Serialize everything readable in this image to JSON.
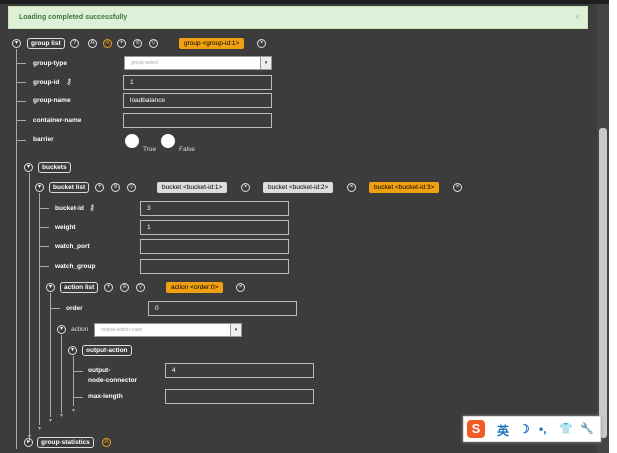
{
  "alert": {
    "message": "Loading completed successfully",
    "close": "×"
  },
  "group_list": {
    "label": "group list",
    "key_button": "group  <group-id:1>",
    "fields": {
      "group_type": {
        "label": "group-type",
        "value": "group-select"
      },
      "group_id": {
        "label": "group-id",
        "value": "1"
      },
      "group_name": {
        "label": "group-name",
        "value": "loadbalance"
      },
      "container_name": {
        "label": "container-name",
        "value": ""
      },
      "barrier": {
        "label": "barrier",
        "true_label": "True",
        "false_label": "False"
      }
    }
  },
  "buckets": {
    "label": "buckets",
    "bucket_list": {
      "label": "bucket list",
      "keys": [
        "bucket  <bucket-id:1>",
        "bucket  <bucket-id:2>",
        "bucket  <bucket-id:3>"
      ],
      "fields": {
        "bucket_id": {
          "label": "bucket-id",
          "value": "3"
        },
        "weight": {
          "label": "weight",
          "value": "1"
        },
        "watch_port": {
          "label": "watch_port",
          "value": ""
        },
        "watch_group": {
          "label": "watch_group",
          "value": ""
        }
      },
      "action_list": {
        "label": "action list",
        "key_button": "action  <order:0>",
        "order": {
          "label": "order",
          "value": "0"
        },
        "action": {
          "label": "action",
          "value": "output-action-case"
        },
        "output_action": {
          "label": "output-action",
          "node_connector_label_1": "output-",
          "node_connector_label_2": "node-connector",
          "node_connector_value": "4",
          "max_length_label": "max-length",
          "max_length_value": ""
        }
      }
    }
  },
  "group_statistics": {
    "label": "group-statistics"
  },
  "icons": {
    "add": "+",
    "remove": "×",
    "help": "?",
    "augment": "A",
    "filter": "▽",
    "list": "≡",
    "expand": "▾",
    "collapse": "▸",
    "key": "⚷"
  },
  "ime_bar": {
    "logo": "S",
    "lang": "英",
    "moon": "☽",
    "punct": "•,",
    "shirt": "👕",
    "tool": "🔧"
  },
  "colors": {
    "background": "#3c3c3c",
    "accent": "#f0a010",
    "alert_bg": "#dff0d8",
    "alert_text": "#3c763d"
  }
}
